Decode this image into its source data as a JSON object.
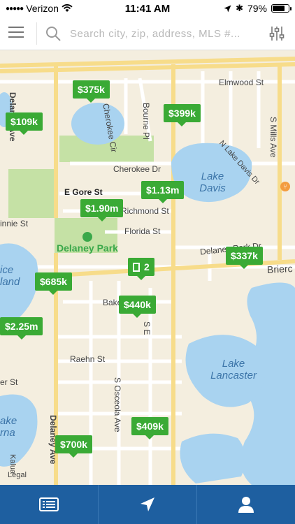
{
  "status_bar": {
    "carrier": "Verizon",
    "time": "11:41 AM",
    "battery": "79%",
    "battery_level": 0.79
  },
  "search": {
    "placeholder": "Search city, zip, address, MLS #..."
  },
  "map": {
    "street_labels": {
      "elmwood": "Elmwood St",
      "cherokee_cir": "Cherokee Cir",
      "bourne_pl": "Bourne Pl",
      "n_lake_davis": "N Lake Davis Dr",
      "s_mills": "S Mills Ave",
      "e_gore": "E Gore St",
      "richmond": "Richmond St",
      "florida": "Florida St",
      "cherokee_dr": "Cherokee Dr",
      "delaney_park_dr": "Delaney Park Dr",
      "briercliff": "Brierc",
      "baker": "Bake",
      "raehn": "Raehn St",
      "s_osceola": "S Osceola Ave",
      "delaney_ave": "Delaney Ave",
      "delaney_ave_top": "Delaney Ave",
      "minnie": "innie St",
      "er_st": "er St",
      "s_e": "S E",
      "kalua": "Kalua",
      "legal": "Legal"
    },
    "water_labels": {
      "lake_davis": "Lake\nDavis",
      "lake_lancaster": "Lake\nLancaster",
      "island_left": "ice\nland",
      "lake_bottom_left": "ake\nrna"
    },
    "park": {
      "name": "Delaney Park"
    },
    "pins": [
      {
        "label": "$375k"
      },
      {
        "label": "$109k"
      },
      {
        "label": "$399k"
      },
      {
        "label": "$1.13m"
      },
      {
        "label": "$1.90m"
      },
      {
        "label": "$337k"
      },
      {
        "label": "$685k"
      },
      {
        "label": "$440k"
      },
      {
        "label": "$2.25m"
      },
      {
        "label": "$409k"
      },
      {
        "label": "$700k"
      }
    ],
    "cluster": {
      "count": "2"
    }
  },
  "colors": {
    "pin_green": "#3aaa35",
    "water": "#a9d3f0",
    "park_green": "#c5e1a5",
    "tab_blue": "#1e5fa0"
  },
  "tabs": [
    {
      "icon": "list-icon"
    },
    {
      "icon": "location-arrow-icon"
    },
    {
      "icon": "user-icon"
    }
  ]
}
